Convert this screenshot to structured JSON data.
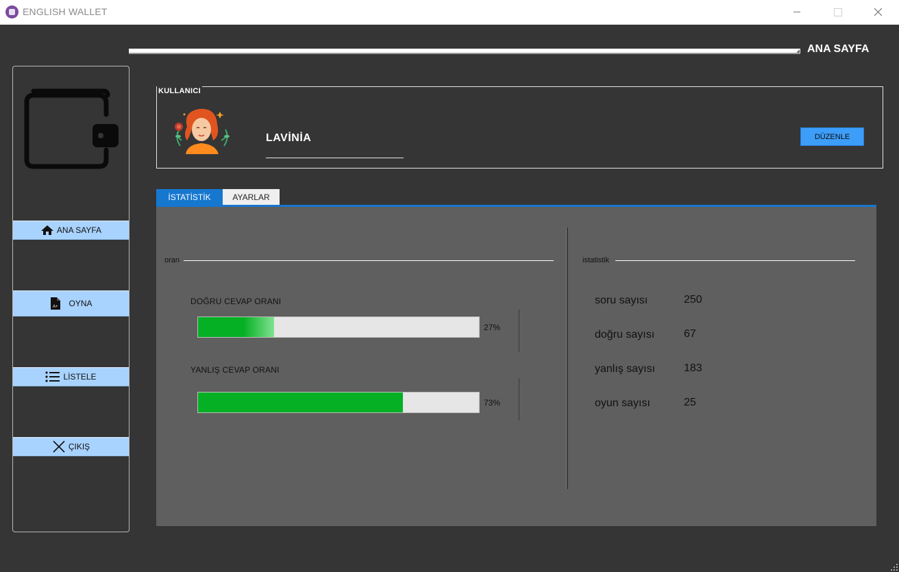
{
  "window": {
    "title": "ENGLISH WALLET"
  },
  "header": {
    "page_title": "ANA SAYFA"
  },
  "sidebar": {
    "items": [
      {
        "label": "ANA SAYFA",
        "icon": "home-icon"
      },
      {
        "label": "OYNA",
        "icon": "document-grade-icon"
      },
      {
        "label": "LİSTELE",
        "icon": "list-icon"
      },
      {
        "label": "ÇIKIŞ",
        "icon": "close-icon"
      }
    ],
    "logo_icon": "wallet-icon"
  },
  "user": {
    "group_title": "KULLANICI",
    "name": "LAVİNİA",
    "edit_label": "DÜZENLE",
    "avatar_icon": "woman-avatar-icon"
  },
  "tabs": [
    {
      "label": "İSTATİSTİK",
      "active": true
    },
    {
      "label": "AYARLAR",
      "active": false
    }
  ],
  "ratio": {
    "group_title": "oran",
    "bars": [
      {
        "label": "DOĞRU CEVAP ORANI",
        "value": 27,
        "text": "27%"
      },
      {
        "label": "YANLIŞ CEVAP ORANI",
        "value": 73,
        "text": "73%"
      }
    ]
  },
  "stats": {
    "group_title": "istatistik",
    "rows": [
      {
        "label": "soru sayısı",
        "value": "250"
      },
      {
        "label": "doğru sayısı",
        "value": "67"
      },
      {
        "label": "yanlış sayısı",
        "value": "183"
      },
      {
        "label": "oyun sayısı",
        "value": "25"
      }
    ]
  },
  "colors": {
    "background": "#353535",
    "panel": "#5f5f5f",
    "accent": "#1677cf",
    "nav_button": "#a9d3ff",
    "edit_button": "#3d9ef9",
    "progress_fill": "#06b025"
  }
}
